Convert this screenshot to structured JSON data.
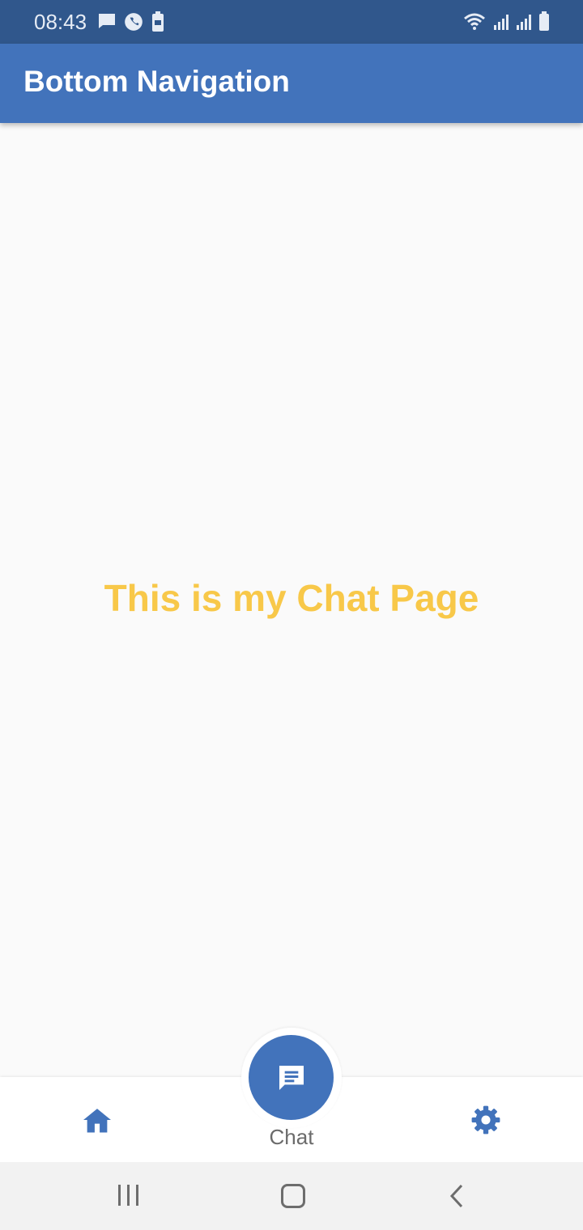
{
  "status_bar": {
    "time": "08:43",
    "left_icons": [
      "message-icon",
      "whatsapp-icon",
      "battery-saver-icon"
    ],
    "right_icons": [
      "wifi-icon",
      "signal-icon",
      "signal-icon",
      "battery-icon"
    ]
  },
  "app_bar": {
    "title": "Bottom Navigation"
  },
  "content": {
    "message": "This is my Chat Page"
  },
  "bottom_nav": {
    "items": [
      {
        "icon": "home-icon",
        "label": ""
      },
      {
        "icon": "chat-icon",
        "label": "Chat",
        "selected": true
      },
      {
        "icon": "settings-icon",
        "label": ""
      }
    ]
  },
  "system_nav": {
    "buttons": [
      "recents",
      "home",
      "back"
    ]
  },
  "colors": {
    "status_bar": "#30578c",
    "app_bar": "#4273bb",
    "accent_text": "#f8c849",
    "background": "#fafafa"
  }
}
